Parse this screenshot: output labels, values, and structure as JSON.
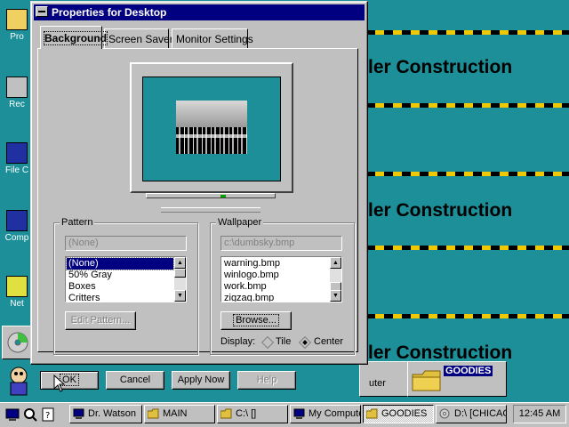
{
  "desktop": {
    "banner_text": "ler Construction",
    "icon_labels": [
      "Pro",
      "Rec",
      "File C",
      "Comp",
      "Net"
    ]
  },
  "dialog": {
    "title": "Properties for Desktop",
    "tabs": [
      {
        "label": "Background",
        "active": true
      },
      {
        "label": "Screen Saver",
        "active": false
      },
      {
        "label": "Monitor Settings",
        "active": false
      }
    ],
    "pattern": {
      "group_label": "Pattern",
      "value": "(None)",
      "items": [
        "(None)",
        "50% Gray",
        "Boxes",
        "Critters"
      ],
      "selected_index": 0,
      "edit_button": "Edit Pattern..."
    },
    "wallpaper": {
      "group_label": "Wallpaper",
      "value": "c:\\dumbsky.bmp",
      "items": [
        "warning.bmp",
        "winlogo.bmp",
        "work.bmp",
        "zigzag.bmp"
      ],
      "browse_button": "Browse...",
      "display_label": "Display:",
      "tile_label": "Tile",
      "center_label": "Center",
      "display_mode": "Center"
    },
    "buttons": {
      "ok": "OK",
      "cancel": "Cancel",
      "apply": "Apply Now",
      "help": "Help"
    }
  },
  "background_windows": {
    "goodies_folder_label": "GOODIES",
    "computer_label": "uter"
  },
  "taskbar": {
    "tasks": [
      {
        "label": "Dr. Watson",
        "icon": "computer-icon"
      },
      {
        "label": "MAIN",
        "icon": "folder-icon"
      },
      {
        "label": "C:\\ []",
        "icon": "folder-icon"
      },
      {
        "label": "My Compute",
        "icon": "computer-icon"
      },
      {
        "label": "GOODIES",
        "icon": "folder-icon",
        "pressed": true
      },
      {
        "label": "D:\\ [CHICAG",
        "icon": "disc-icon"
      }
    ],
    "clock": "12:45 AM"
  },
  "colors": {
    "desktop": "#1c8f98",
    "title_active": "#000080",
    "face": "#c0c0c0",
    "stripe_yellow": "#f0c800"
  }
}
